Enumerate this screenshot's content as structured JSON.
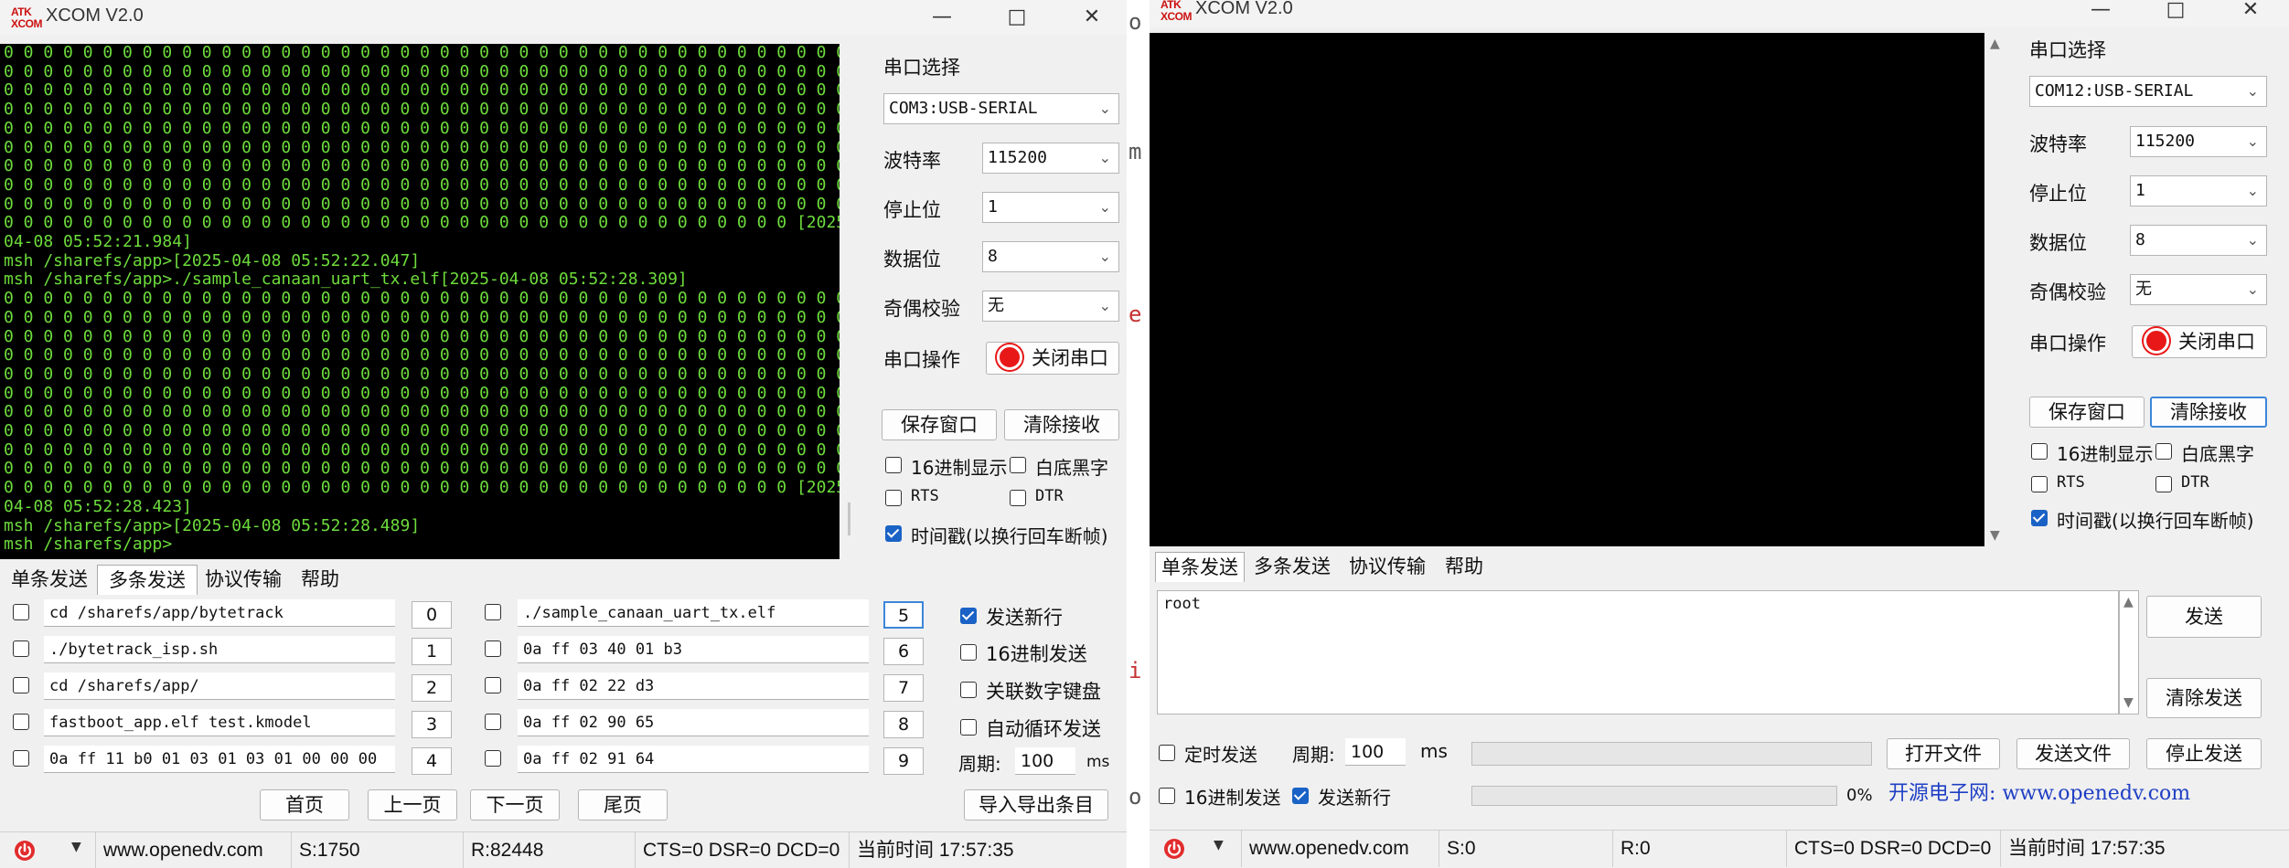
{
  "left_window": {
    "title": "XCOM V2.0",
    "logo_text": [
      "ATK",
      "XCOM"
    ],
    "terminal_lines": [
      "0 0 0 0 0 0 0 0 0 0 0 0 0 0 0 0 0 0 0 0 0 0 0 0 0 0 0 0 0 0 0 0 0 0 0 0 0 0 0 0 0 0 0 0 0 0 0",
      "0 0 0 0 0 0 0 0 0 0 0 0 0 0 0 0 0 0 0 0 0 0 0 0 0 0 0 0 0 0 0 0 0 0 0 0 0 0 0 0 0 0 0 0 0 0 0",
      "0 0 0 0 0 0 0 0 0 0 0 0 0 0 0 0 0 0 0 0 0 0 0 0 0 0 0 0 0 0 0 0 0 0 0 0 0 0 0 0 0 0 0 0 0 0 0",
      "0 0 0 0 0 0 0 0 0 0 0 0 0 0 0 0 0 0 0 0 0 0 0 0 0 0 0 0 0 0 0 0 0 0 0 0 0 0 0 0 0 0 0 0 0 0 0",
      "0 0 0 0 0 0 0 0 0 0 0 0 0 0 0 0 0 0 0 0 0 0 0 0 0 0 0 0 0 0 0 0 0 0 0 0 0 0 0 0 0 0 0 0 0 0 0",
      "0 0 0 0 0 0 0 0 0 0 0 0 0 0 0 0 0 0 0 0 0 0 0 0 0 0 0 0 0 0 0 0 0 0 0 0 0 0 0 0 0 0 0 0 0 0 0",
      "0 0 0 0 0 0 0 0 0 0 0 0 0 0 0 0 0 0 0 0 0 0 0 0 0 0 0 0 0 0 0 0 0 0 0 0 0 0 0 0 0 0 0 0 0 0 0",
      "0 0 0 0 0 0 0 0 0 0 0 0 0 0 0 0 0 0 0 0 0 0 0 0 0 0 0 0 0 0 0 0 0 0 0 0 0 0 0 0 0 0 0 0 0 0 0",
      "0 0 0 0 0 0 0 0 0 0 0 0 0 0 0 0 0 0 0 0 0 0 0 0 0 0 0 0 0 0 0 0 0 0 0 0 0 0 0 0 0 0 0 0 0 0 0",
      "0 0 0 0 0 0 0 0 0 0 0 0 0 0 0 0 0 0 0 0 0 0 0 0 0 0 0 0 0 0 0 0 0 0 0 0 0 0 0 0 [2025-",
      "04-08 05:52:21.984]",
      "msh /sharefs/app>[2025-04-08 05:52:22.047]",
      "msh /sharefs/app>./sample_canaan_uart_tx.elf[2025-04-08 05:52:28.309]",
      "0 0 0 0 0 0 0 0 0 0 0 0 0 0 0 0 0 0 0 0 0 0 0 0 0 0 0 0 0 0 0 0 0 0 0 0 0 0 0 0 0 0 0 0 0 0 0",
      "0 0 0 0 0 0 0 0 0 0 0 0 0 0 0 0 0 0 0 0 0 0 0 0 0 0 0 0 0 0 0 0 0 0 0 0 0 0 0 0 0 0 0 0 0 0 0",
      "0 0 0 0 0 0 0 0 0 0 0 0 0 0 0 0 0 0 0 0 0 0 0 0 0 0 0 0 0 0 0 0 0 0 0 0 0 0 0 0 0 0 0 0 0 0 0",
      "0 0 0 0 0 0 0 0 0 0 0 0 0 0 0 0 0 0 0 0 0 0 0 0 0 0 0 0 0 0 0 0 0 0 0 0 0 0 0 0 0 0 0 0 0 0 0",
      "0 0 0 0 0 0 0 0 0 0 0 0 0 0 0 0 0 0 0 0 0 0 0 0 0 0 0 0 0 0 0 0 0 0 0 0 0 0 0 0 0 0 0 0 0 0 0",
      "0 0 0 0 0 0 0 0 0 0 0 0 0 0 0 0 0 0 0 0 0 0 0 0 0 0 0 0 0 0 0 0 0 0 0 0 0 0 0 0 0 0 0 0 0 0 0",
      "0 0 0 0 0 0 0 0 0 0 0 0 0 0 0 0 0 0 0 0 0 0 0 0 0 0 0 0 0 0 0 0 0 0 0 0 0 0 0 0 0 0 0 0 0 0 0",
      "0 0 0 0 0 0 0 0 0 0 0 0 0 0 0 0 0 0 0 0 0 0 0 0 0 0 0 0 0 0 0 0 0 0 0 0 0 0 0 0 0 0 0 0 0 0 0",
      "0 0 0 0 0 0 0 0 0 0 0 0 0 0 0 0 0 0 0 0 0 0 0 0 0 0 0 0 0 0 0 0 0 0 0 0 0 0 0 0 0 0 0 0 0 0 0",
      "0 0 0 0 0 0 0 0 0 0 0 0 0 0 0 0 0 0 0 0 0 0 0 0 0 0 0 0 0 0 0 0 0 0 0 0 0 0 0 0 0 0 0 0 0 0 0",
      "0 0 0 0 0 0 0 0 0 0 0 0 0 0 0 0 0 0 0 0 0 0 0 0 0 0 0 0 0 0 0 0 0 0 0 0 0 0 0 0 [2025-",
      "04-08 05:52:28.423]",
      "msh /sharefs/app>[2025-04-08 05:52:28.489]",
      "msh /sharefs/app>"
    ],
    "settings": {
      "port_label": "串口选择",
      "port_value": "COM3:USB-SERIAL",
      "baud_label": "波特率",
      "baud_value": "115200",
      "stop_label": "停止位",
      "stop_value": "1",
      "data_label": "数据位",
      "data_value": "8",
      "parity_label": "奇偶校验",
      "parity_value": "无",
      "op_label": "串口操作",
      "op_button": "关闭串口",
      "save_window": "保存窗口",
      "clear_receive": "清除接收",
      "hex_display": "16进制显示",
      "white_bg": "白底黑字",
      "rts": "RTS",
      "dtr": "DTR",
      "timestamp": "时间戳(以换行回车断帧)"
    },
    "tabs": [
      "单条发送",
      "多条发送",
      "协议传输",
      "帮助"
    ],
    "multi_send": {
      "left": [
        {
          "text": "cd /sharefs/app/bytetrack",
          "num": "0"
        },
        {
          "text": "./bytetrack_isp.sh",
          "num": "1"
        },
        {
          "text": "cd /sharefs/app/",
          "num": "2"
        },
        {
          "text": "fastboot_app.elf test.kmodel",
          "num": "3"
        },
        {
          "text": "0a ff 11 b0 01 03 01 03 01 00 00 00",
          "num": "4"
        }
      ],
      "right": [
        {
          "text": "./sample_canaan_uart_tx.elf",
          "num": "5"
        },
        {
          "text": "0a ff 03 40 01 b3",
          "num": "6"
        },
        {
          "text": "0a ff 02 22 d3",
          "num": "7"
        },
        {
          "text": "0a ff 02 90 65",
          "num": "8"
        },
        {
          "text": "0a ff 02 91 64",
          "num": "9"
        }
      ],
      "opt_newline": "发送新行",
      "opt_hex": "16进制发送",
      "opt_keyboard": "关联数字键盘",
      "opt_loop": "自动循环发送",
      "period_label": "周期:",
      "period_value": "100",
      "period_unit": "ms",
      "first_page": "首页",
      "prev_page": "上一页",
      "next_page": "下一页",
      "last_page": "尾页",
      "import_export": "导入导出条目"
    },
    "status": {
      "url": "www.openedv.com",
      "sent": "S:1750",
      "recv": "R:82448",
      "lines": "CTS=0 DSR=0 DCD=0",
      "time": "当前时间 17:57:35"
    }
  },
  "right_window": {
    "title": "XCOM V2.0",
    "logo_text": [
      "ATK",
      "XCOM"
    ],
    "settings": {
      "port_label": "串口选择",
      "port_value": "COM12:USB-SERIAL",
      "baud_label": "波特率",
      "baud_value": "115200",
      "stop_label": "停止位",
      "stop_value": "1",
      "data_label": "数据位",
      "data_value": "8",
      "parity_label": "奇偶校验",
      "parity_value": "无",
      "op_label": "串口操作",
      "op_button": "关闭串口",
      "save_window": "保存窗口",
      "clear_receive": "清除接收",
      "hex_display": "16进制显示",
      "white_bg": "白底黑字",
      "rts": "RTS",
      "dtr": "DTR",
      "timestamp": "时间戳(以换行回车断帧)"
    },
    "tabs": [
      "单条发送",
      "多条发送",
      "协议传输",
      "帮助"
    ],
    "single_send": {
      "text": "root",
      "send": "发送",
      "clear_send": "清除发送",
      "timed_send": "定时发送",
      "period_label": "周期:",
      "period_value": "100",
      "period_unit": "ms",
      "open_file": "打开文件",
      "send_file": "发送文件",
      "stop_send": "停止发送",
      "hex_send": "16进制发送",
      "send_newline": "发送新行",
      "progress_pct": "0%",
      "brand": "开源电子网: www.openedv.com"
    },
    "status": {
      "url": "www.openedv.com",
      "sent": "S:0",
      "recv": "R:0",
      "lines": "CTS=0 DSR=0 DCD=0",
      "time": "当前时间 17:57:35"
    }
  },
  "background_glyphs": [
    "o",
    "m",
    "e",
    "i",
    "o"
  ],
  "colors": {
    "terminal_bg": "#000000",
    "terminal_fg": "#6ddc3c",
    "accent": "#1a62c5",
    "brand": "#1f3fc4"
  }
}
